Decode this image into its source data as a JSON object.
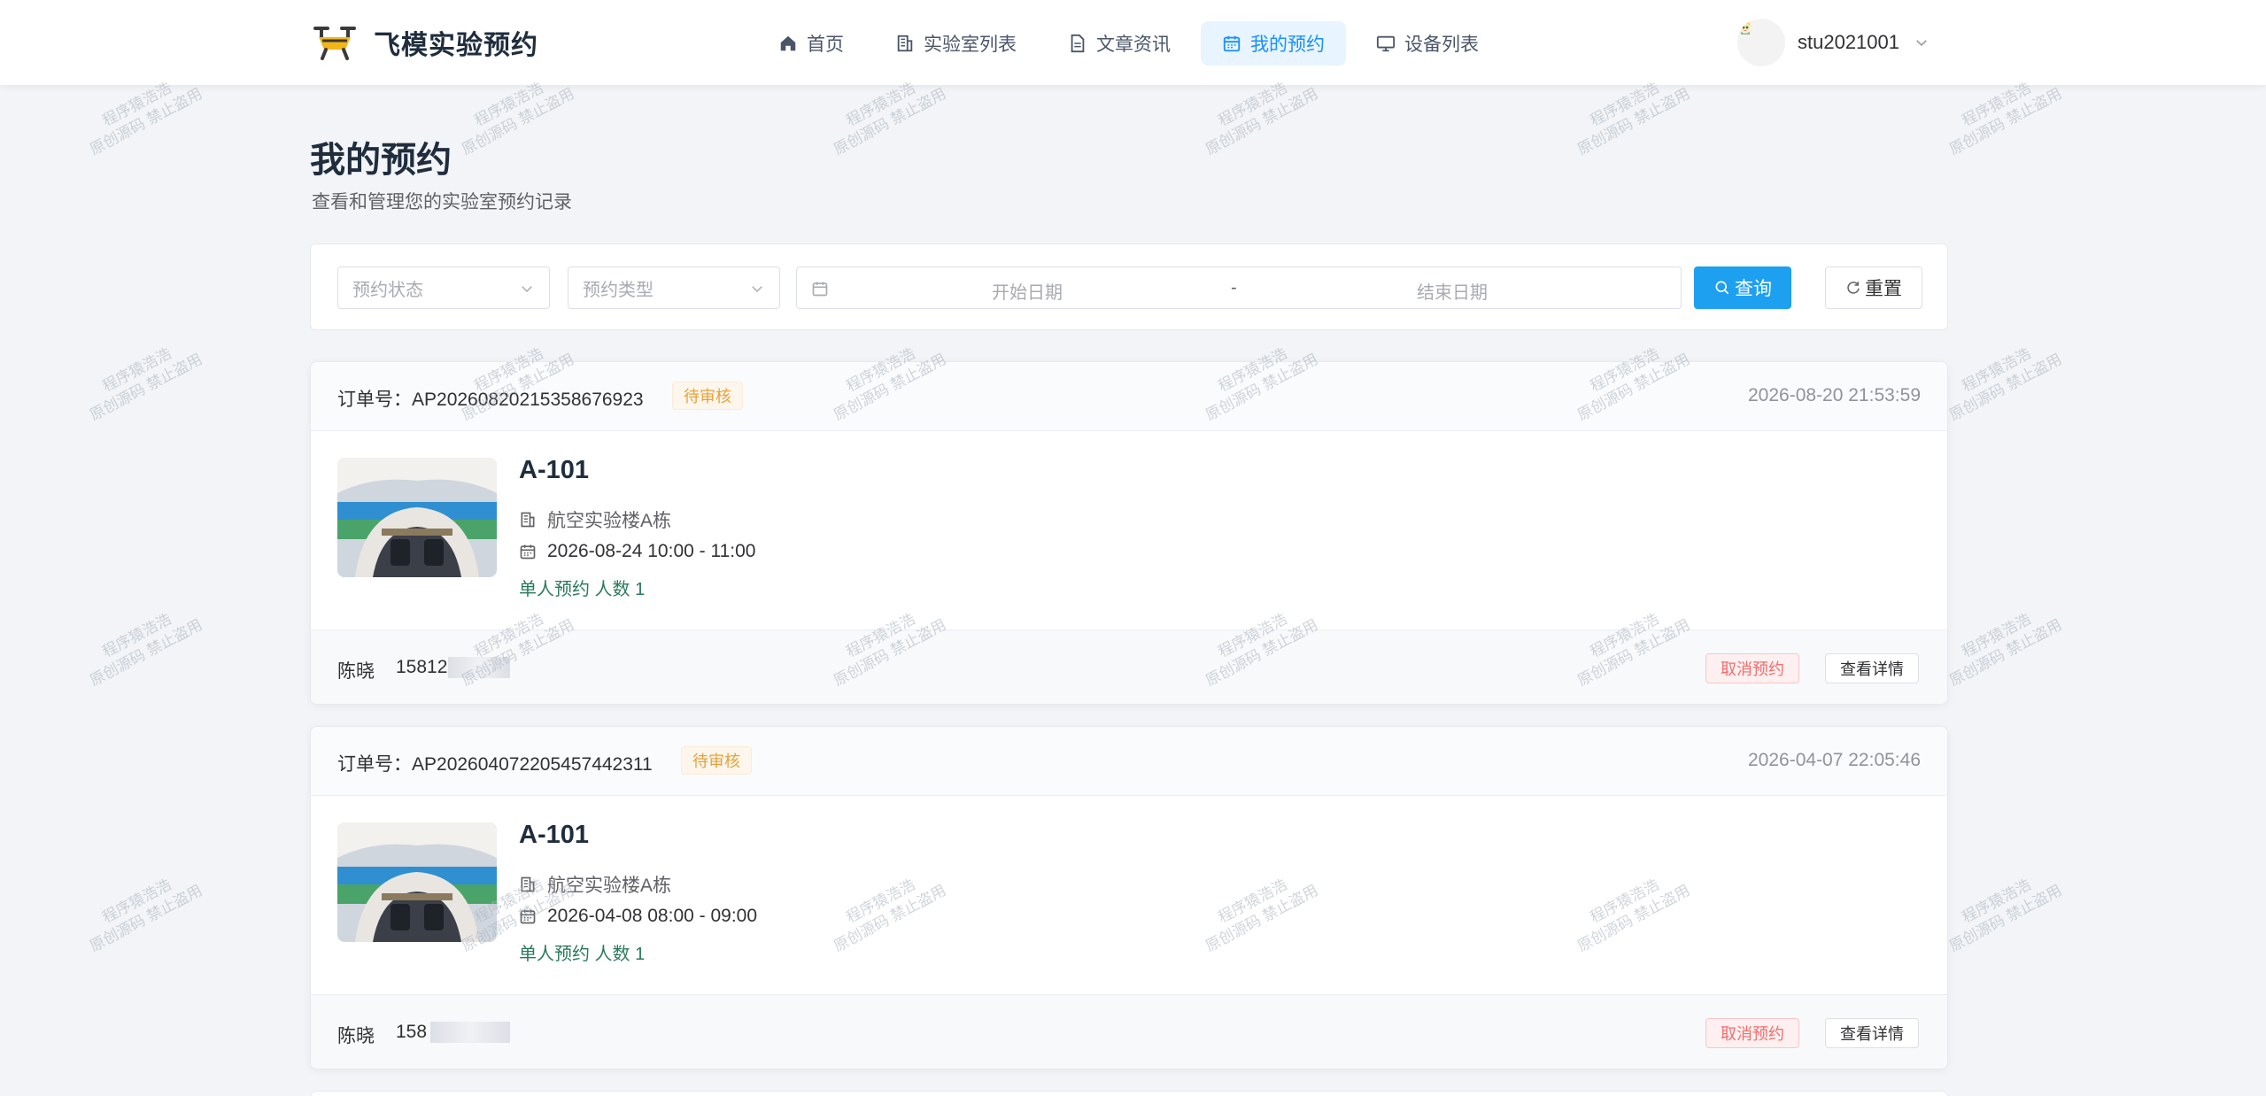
{
  "brand": {
    "name": "飞模实验预约",
    "icon": "drone-icon"
  },
  "nav": {
    "items": [
      {
        "label": "首页",
        "icon": "home-icon"
      },
      {
        "label": "实验室列表",
        "icon": "building-icon"
      },
      {
        "label": "文章资讯",
        "icon": "document-icon"
      },
      {
        "label": "我的预约",
        "icon": "calendar-icon",
        "active": true
      },
      {
        "label": "设备列表",
        "icon": "monitor-icon"
      }
    ]
  },
  "user": {
    "name": "stu2021001"
  },
  "page": {
    "title": "我的预约",
    "subtitle": "查看和管理您的实验室预约记录"
  },
  "filters": {
    "status_placeholder": "预约状态",
    "type_placeholder": "预约类型",
    "start_placeholder": "开始日期",
    "separator": "-",
    "end_placeholder": "结束日期",
    "query_label": "查询",
    "reset_label": "重置"
  },
  "orders": [
    {
      "order_label": "订单号：AP20260820215358676923",
      "status": "待审核",
      "created_at": "2026-08-20 21:53:59",
      "room": "A-101",
      "building": "航空实验楼A栋",
      "time": "2026-08-24 10:00 - 11:00",
      "kind": "单人预约  人数 1",
      "contact_name": "陈晓",
      "contact_phone": "15812",
      "cancel_label": "取消预约",
      "detail_label": "查看详情"
    },
    {
      "order_label": "订单号：AP20260407220545744231​1",
      "status": "待审核",
      "created_at": "2026-04-07 22:05:46",
      "room": "A-101",
      "building": "航空实验楼A栋",
      "time": "2026-04-08 08:00 - 09:00",
      "kind": "单人预约  人数 1",
      "contact_name": "陈晓",
      "contact_phone": "158",
      "cancel_label": "取消预约",
      "detail_label": "查看详情"
    }
  ],
  "watermark": {
    "line1": "程序猿浩浩",
    "line2": "原创源码 禁止盗用"
  },
  "colors": {
    "accent": "#1890ff",
    "primary_button": "#1ea0f0",
    "pending": "#e6a23c",
    "danger": "#f56c6c"
  }
}
